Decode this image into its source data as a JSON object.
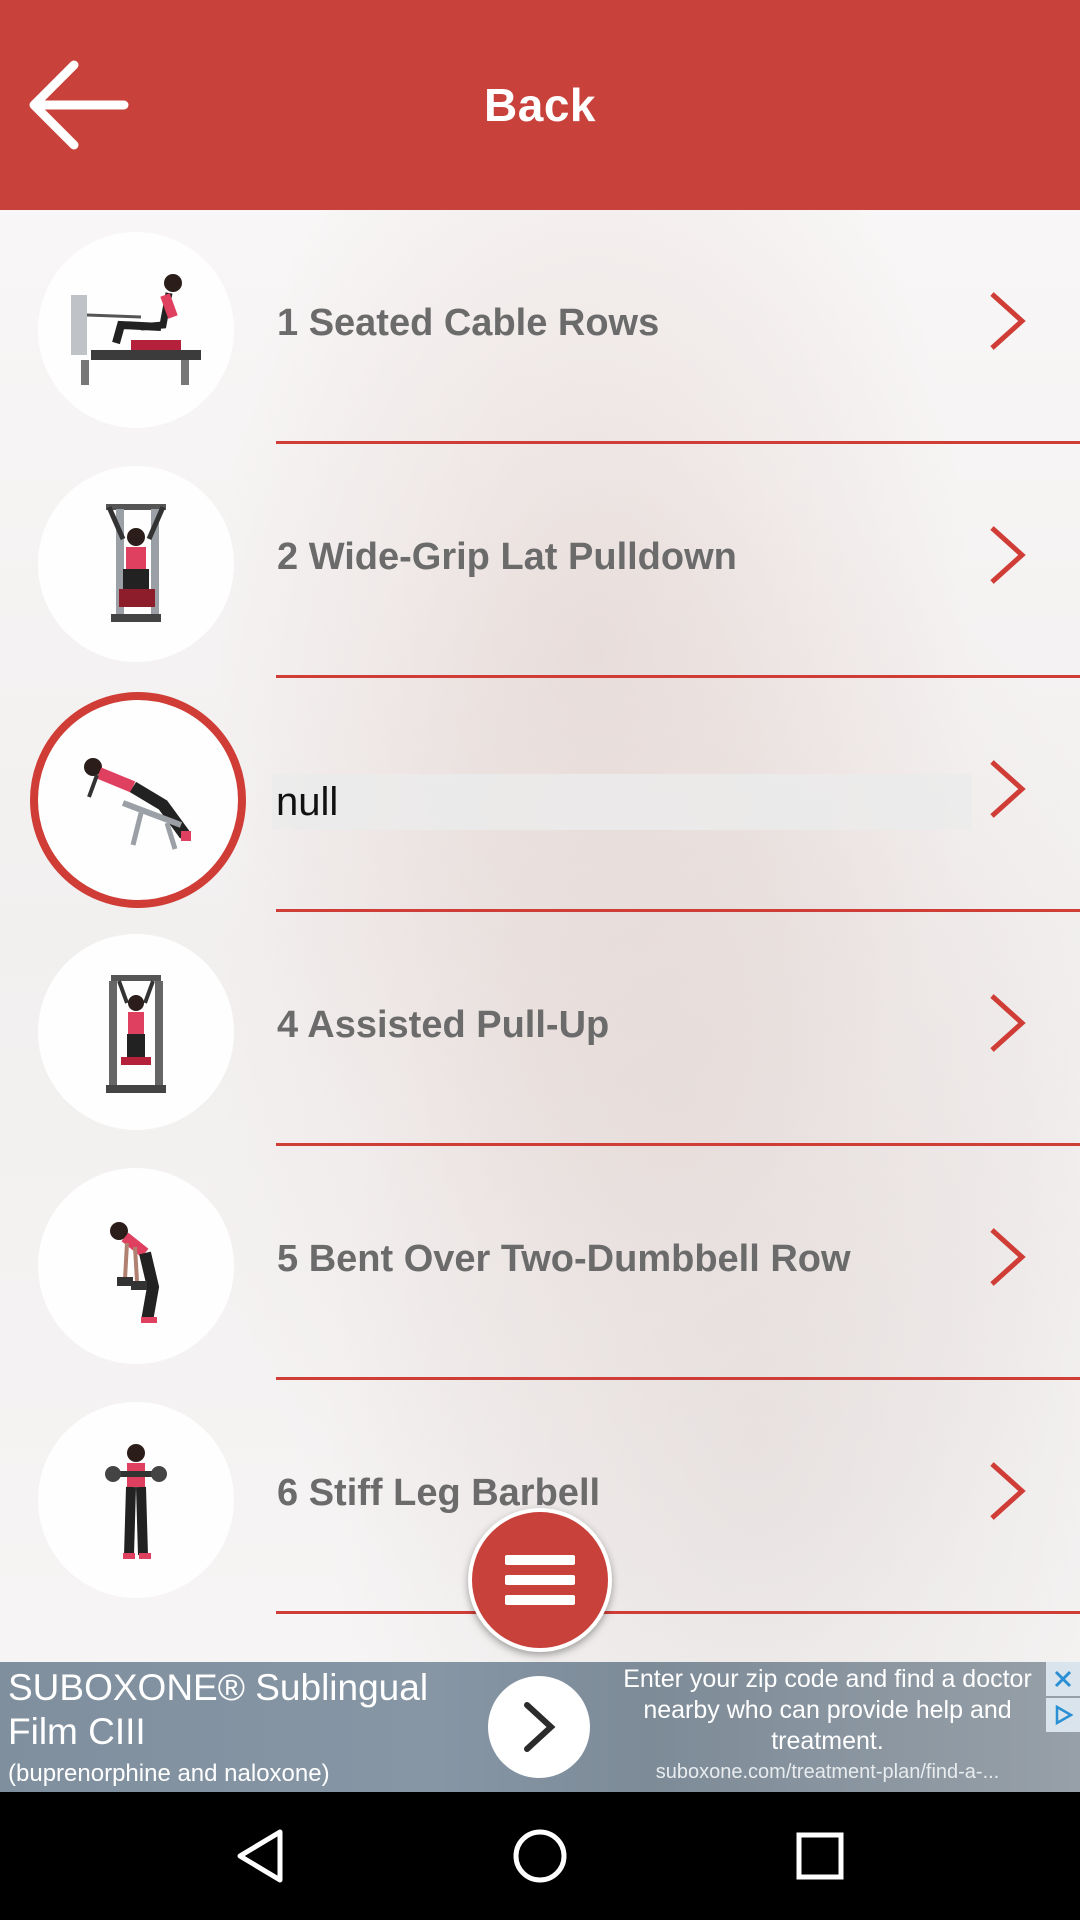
{
  "header": {
    "title": "Back"
  },
  "exercises": [
    {
      "label": "1 Seated Cable Rows",
      "icon": "seated-cable-row-icon"
    },
    {
      "label": "2 Wide-Grip Lat Pulldown",
      "icon": "lat-pulldown-icon"
    },
    {
      "label": "null",
      "icon": "back-extension-icon",
      "selected": true
    },
    {
      "label": "4 Assisted Pull-Up",
      "icon": "assisted-pullup-icon"
    },
    {
      "label": "5 Bent Over Two-Dumbbell Row",
      "icon": "dumbbell-row-icon"
    },
    {
      "label": "6 Stiff Leg Barbell",
      "icon": "barbell-deadlift-icon"
    }
  ],
  "ad": {
    "title": "SUBOXONE® Sublingual Film CIII",
    "subtitle": "(buprenorphine and naloxone)",
    "body": "Enter your zip code and find a doctor nearby who can provide help and treatment.",
    "url": "suboxone.com/treatment-plan/find-a-..."
  },
  "colors": {
    "accent": "#c8413a",
    "divider": "#cf3d36",
    "label": "#6b6b6b"
  }
}
